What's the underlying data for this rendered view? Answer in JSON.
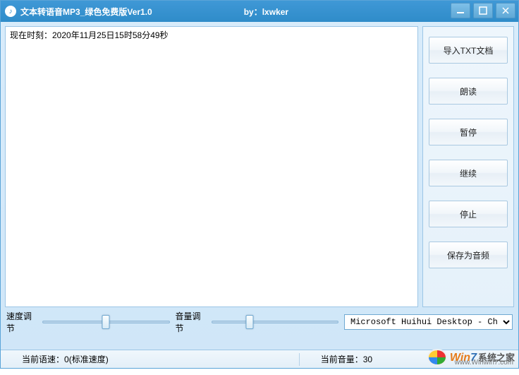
{
  "window": {
    "title": "文本转语音MP3_绿色免费版Ver1.0",
    "byline": "by：lxwker"
  },
  "textarea": {
    "content": "现在时刻：2020年11月25日15时58分49秒"
  },
  "buttons": {
    "import": "导入TXT文档",
    "read": "朗读",
    "pause": "暂停",
    "resume": "继续",
    "stop": "停止",
    "save": "保存为音频"
  },
  "sliders": {
    "speed_label": "速度调节",
    "speed_pos_pct": 50,
    "volume_label": "音量调节",
    "volume_pos_pct": 30
  },
  "voice": {
    "selected": "Microsoft Huihui Desktop - Ch"
  },
  "status": {
    "speed_label": "当前语速：",
    "speed_value": "0(标准速度)",
    "volume_label": "当前音量：",
    "volume_value": "30"
  },
  "watermark": {
    "brand_a": "Win",
    "brand_b": "7",
    "brand_c": "系统之家",
    "url": "www.Winwin7.com"
  }
}
